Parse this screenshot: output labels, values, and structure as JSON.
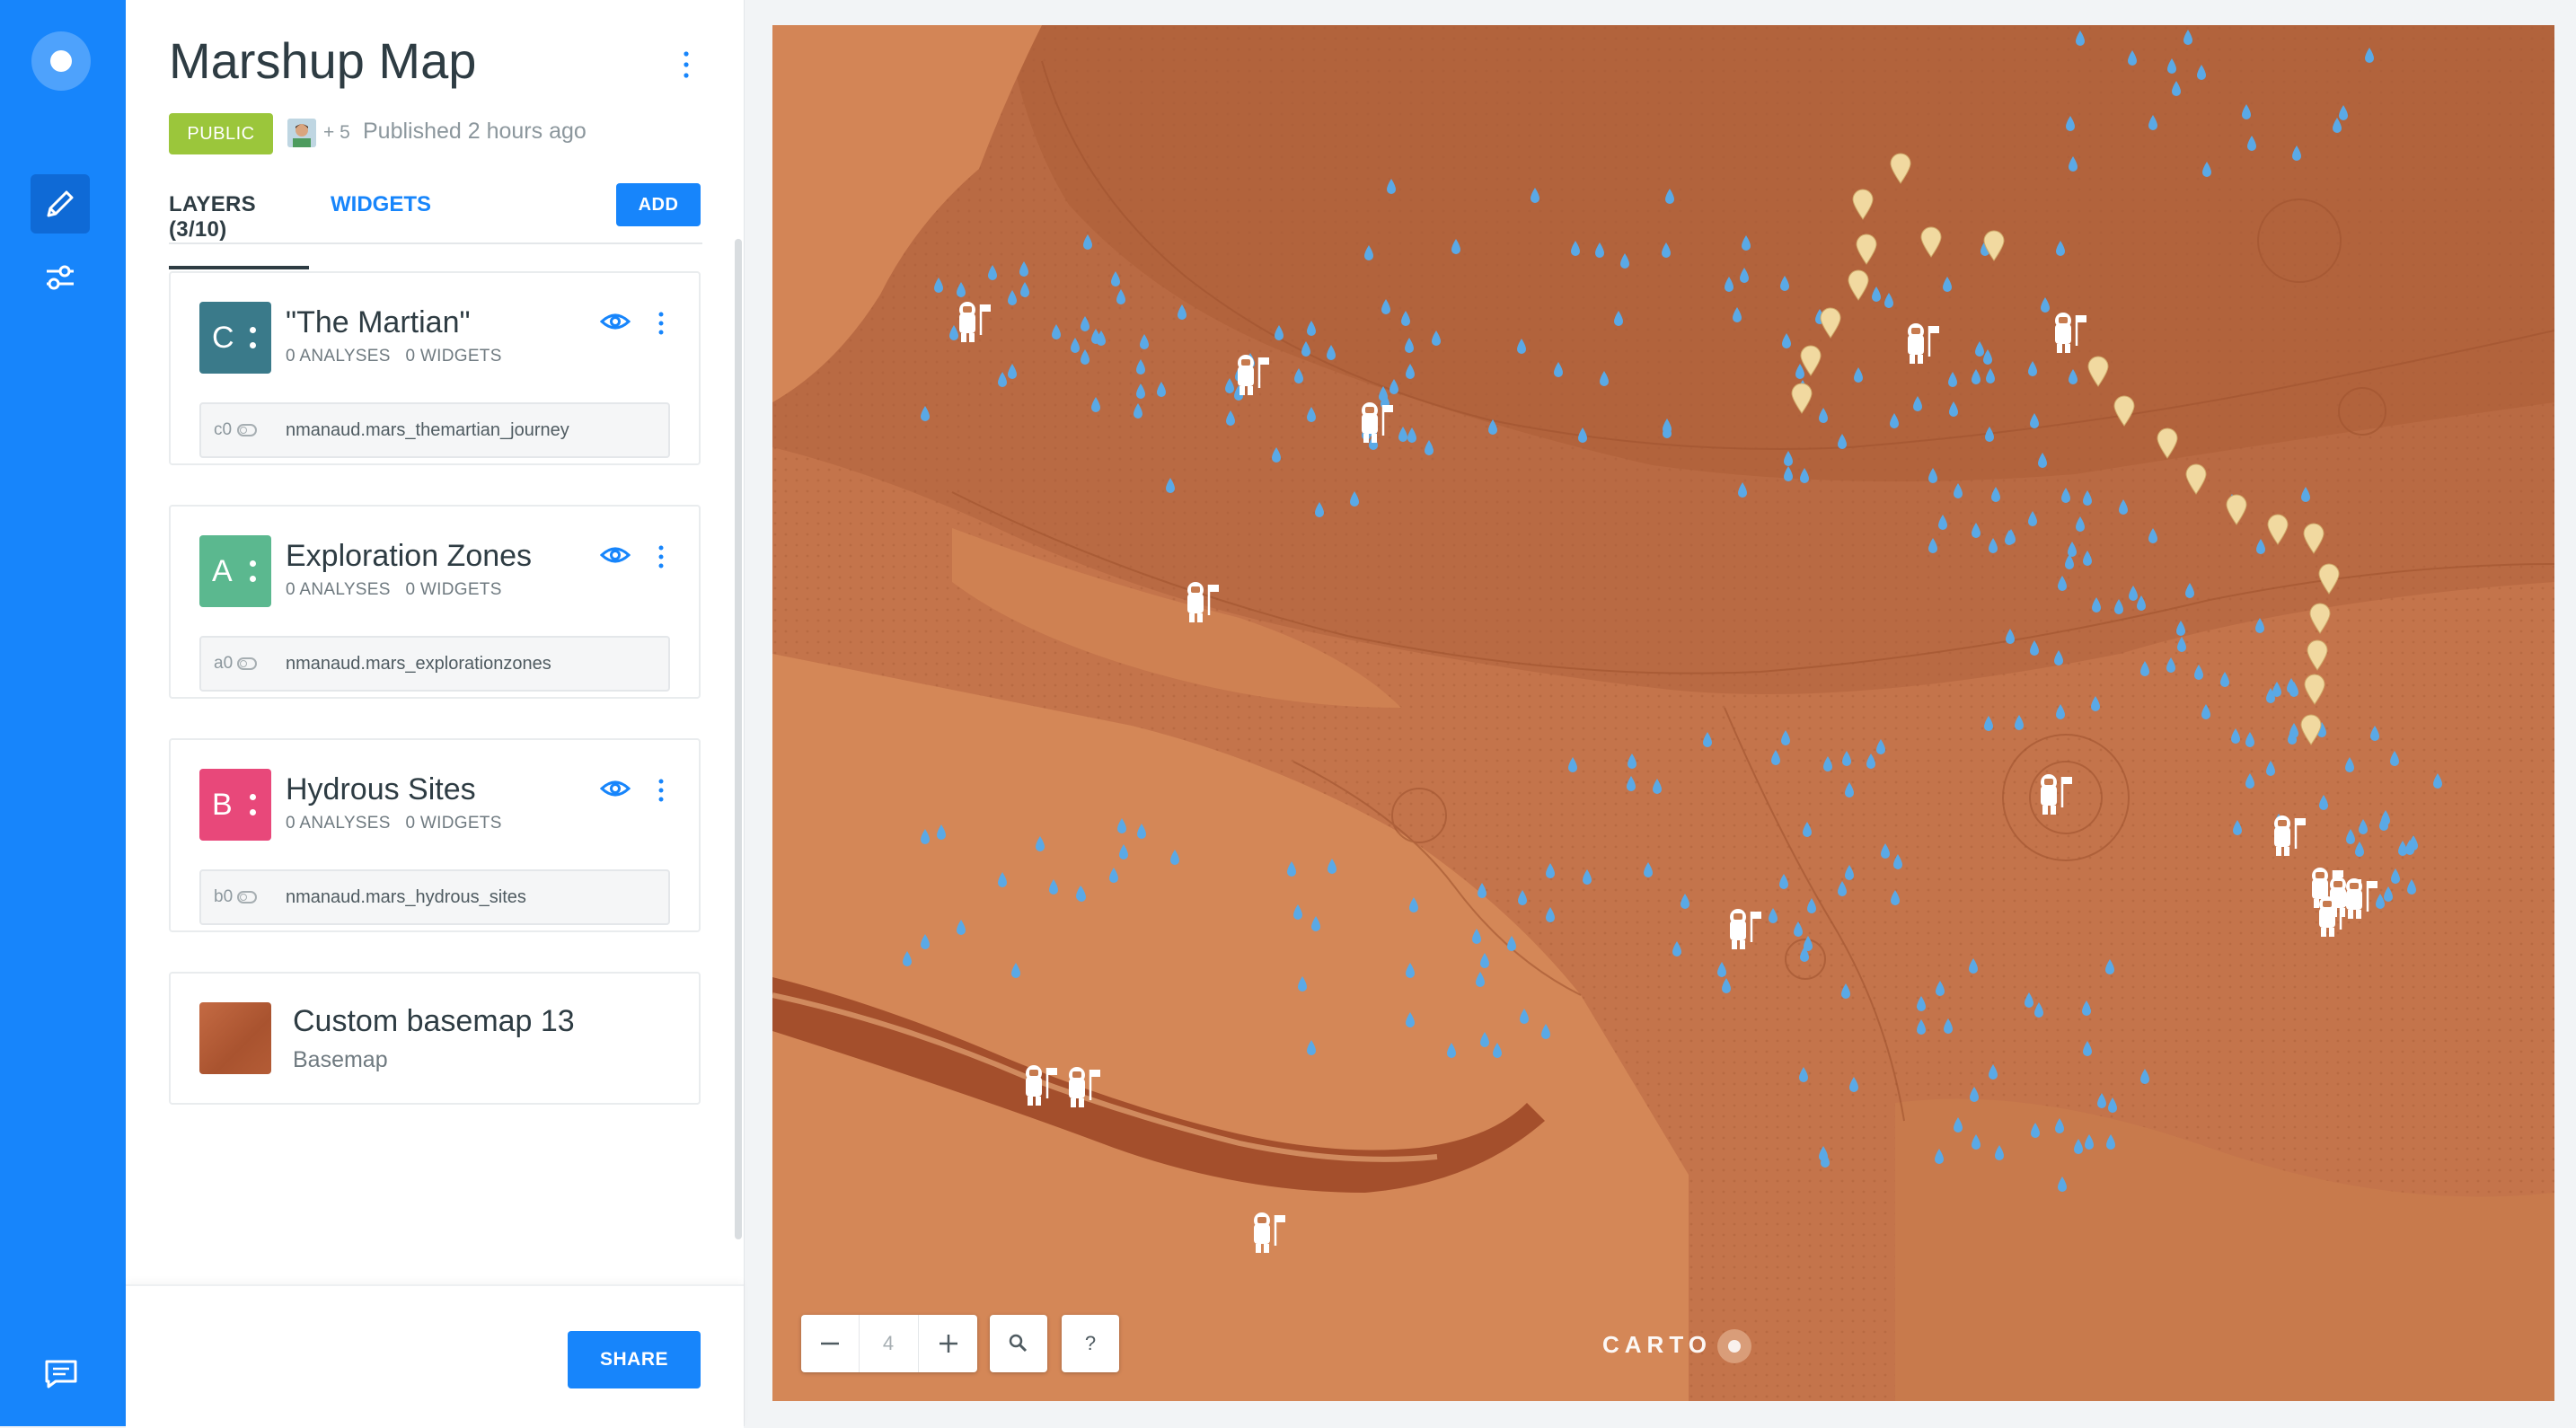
{
  "sidebar": {
    "logo_icon": "carto-logo-icon",
    "items": [
      {
        "icon": "pencil-icon",
        "active": true
      },
      {
        "icon": "sliders-icon",
        "active": false
      }
    ],
    "footer_icon": "chat-icon"
  },
  "panel": {
    "title": "Marshup Map",
    "privacy_badge": "PUBLIC",
    "collaborators": "+ 5",
    "published": "Published 2 hours ago",
    "tabs": [
      {
        "label": "LAYERS (3/10)",
        "active": true
      },
      {
        "label": "WIDGETS",
        "active": false
      }
    ],
    "add_label": "ADD",
    "layers": [
      {
        "letter": "C",
        "color": "#3a7a8a",
        "name": "\"The Martian\"",
        "analyses": "0 ANALYSES",
        "widgets": "0 WIDGETS",
        "source_code": "c0",
        "source": "nmanaud.mars_themartian_journey"
      },
      {
        "letter": "A",
        "color": "#5bb88f",
        "name": "Exploration Zones",
        "analyses": "0 ANALYSES",
        "widgets": "0 WIDGETS",
        "source_code": "a0",
        "source": "nmanaud.mars_explorationzones"
      },
      {
        "letter": "B",
        "color": "#e8487a",
        "name": "Hydrous Sites",
        "analyses": "0 ANALYSES",
        "widgets": "0 WIDGETS",
        "source_code": "b0",
        "source": "nmanaud.mars_hydrous_sites"
      }
    ],
    "basemap": {
      "name": "Custom basemap 13",
      "label": "Basemap"
    },
    "share_label": "SHARE"
  },
  "map": {
    "zoom_level": "4",
    "zoom_out_icon": "minus-icon",
    "zoom_in_icon": "plus-icon",
    "search_icon": "search-icon",
    "help_label": "?",
    "attribution": "CARTO",
    "colors": {
      "terrain": "#c4744b",
      "hydrous": "#5aa9e6",
      "journey": "#f1d9a0",
      "accent": "#1785fb"
    }
  }
}
